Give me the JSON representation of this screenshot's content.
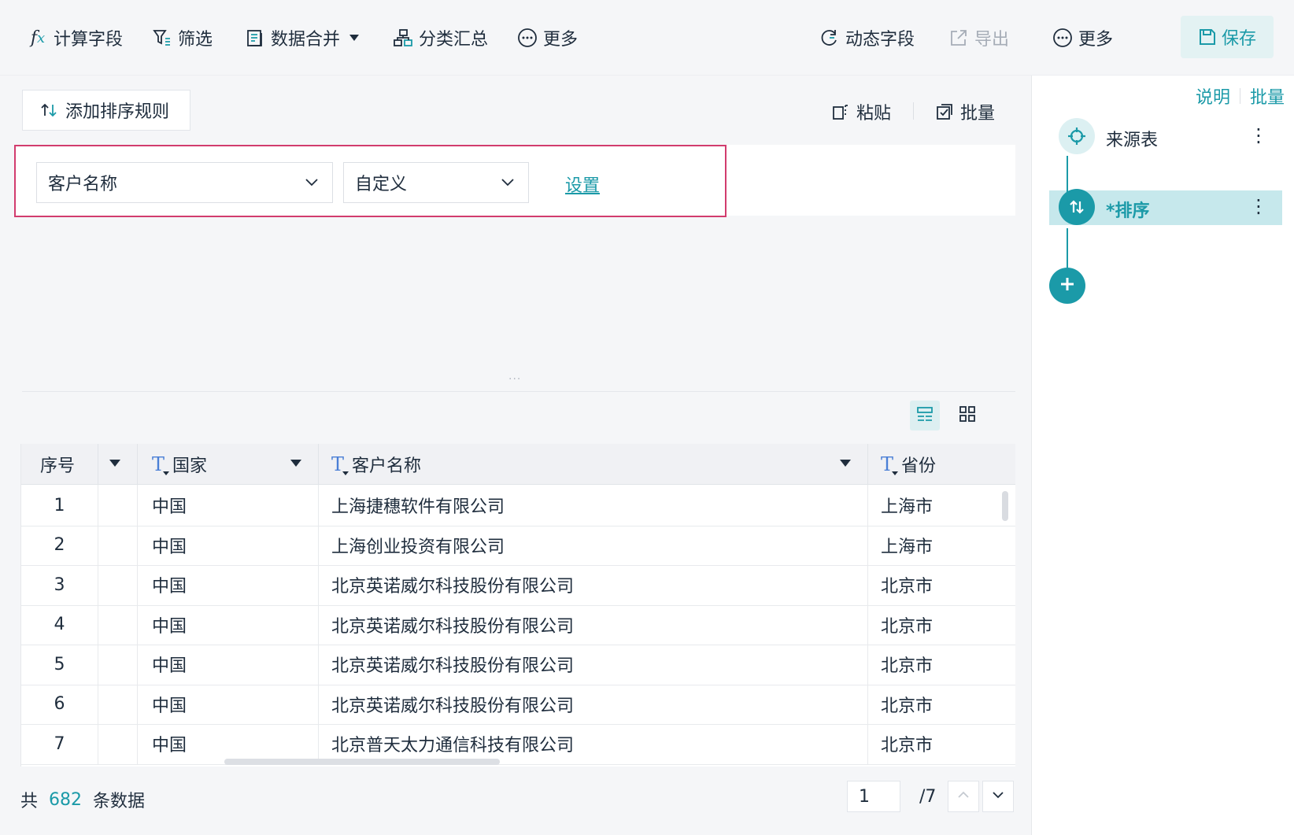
{
  "toolbar": {
    "calc_field": "计算字段",
    "filter": "筛选",
    "merge": "数据合并",
    "group_summary": "分类汇总",
    "more_left": "更多",
    "dynamic_field": "动态字段",
    "export": "导出",
    "more_right": "更多",
    "save": "保存"
  },
  "sort_panel": {
    "add_rule": "添加排序规则",
    "paste": "粘贴",
    "batch": "批量",
    "rule": {
      "field": "客户名称",
      "order": "自定义",
      "settings_link": "设置"
    }
  },
  "table": {
    "headers": [
      "序号",
      "国家",
      "客户名称",
      "省份"
    ],
    "rows": [
      [
        "1",
        "中国",
        "上海捷穗软件有限公司",
        "上海市"
      ],
      [
        "2",
        "中国",
        "上海创业投资有限公司",
        "上海市"
      ],
      [
        "3",
        "中国",
        "北京英诺威尔科技股份有限公司",
        "北京市"
      ],
      [
        "4",
        "中国",
        "北京英诺威尔科技股份有限公司",
        "北京市"
      ],
      [
        "5",
        "中国",
        "北京英诺威尔科技股份有限公司",
        "北京市"
      ],
      [
        "6",
        "中国",
        "北京英诺威尔科技股份有限公司",
        "北京市"
      ],
      [
        "7",
        "中国",
        "北京普天太力通信科技有限公司",
        "北京市"
      ]
    ]
  },
  "footer": {
    "prefix": "共",
    "count": "682",
    "suffix": "条数据",
    "current_page": "1",
    "total_pages": "/7"
  },
  "side_panel": {
    "help": "说明",
    "batch": "批量",
    "steps": [
      {
        "label": "来源表"
      },
      {
        "label": "*排序"
      }
    ]
  },
  "colors": {
    "accent": "#1b9aa8",
    "highlight_frame": "#d23c6e",
    "text": "#1f2d3d",
    "disabled": "#a6adb7"
  }
}
